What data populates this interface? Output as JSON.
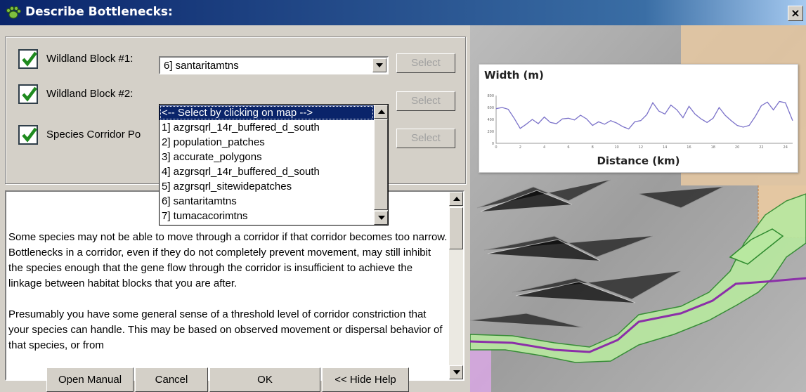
{
  "window": {
    "title": "Describe Bottlenecks:",
    "close_label": "×"
  },
  "inputs": {
    "rows": [
      {
        "checked": true,
        "label": "Wildland Block #1:",
        "select_label": "Select"
      },
      {
        "checked": true,
        "label": "Wildland Block #2:",
        "select_label": "Select"
      },
      {
        "checked": true,
        "label": "Species Corridor Po",
        "select_label": "Select"
      }
    ],
    "block1_value": "6] santaritamtns"
  },
  "dropdown": {
    "items": [
      {
        "label": "<-- Select by clicking on map -->",
        "selected": true
      },
      {
        "label": "1] azgrsqrl_14r_buffered_d_south",
        "selected": false
      },
      {
        "label": "2] population_patches",
        "selected": false
      },
      {
        "label": "3] accurate_polygons",
        "selected": false
      },
      {
        "label": "4] azgrsqrl_14r_buffered_d_south",
        "selected": false
      },
      {
        "label": "5] azgrsqrl_sitewidepatches",
        "selected": false
      },
      {
        "label": "6] santaritamtns",
        "selected": false
      },
      {
        "label": "7] tumacacorimtns",
        "selected": false
      }
    ]
  },
  "help": {
    "paragraphs": [
      "Some species may not be able to move through a corridor if that corridor becomes too narrow.  Bottlenecks in a corridor, even if they do not completely prevent movement, may still inhibit the species enough that the gene flow through the corridor is insufficient to achieve the linkage between habitat blocks that you are after.",
      "Presumably you have some general sense of a threshold level of corridor constriction that your species can handle. This may be based on observed movement or dispersal behavior of that species, or from"
    ]
  },
  "buttons": {
    "open_manual": "Open Manual",
    "cancel": "Cancel",
    "ok": "OK",
    "hide_help": "<< Hide Help"
  },
  "chart_data": {
    "type": "line",
    "ylabel": "Width (m)",
    "xlabel": "Distance (km)",
    "y_ticks": [
      "800",
      "600",
      "400",
      "200",
      "0"
    ],
    "x_ticks": [
      "0",
      "2",
      "4",
      "6",
      "8",
      "10",
      "12",
      "14",
      "16",
      "18",
      "20",
      "22",
      "24"
    ],
    "xlim": [
      0,
      24.6
    ],
    "ylim": [
      0,
      800
    ],
    "series_color": "#7b72c9",
    "x": [
      0,
      0.5,
      1.0,
      1.5,
      2.0,
      2.5,
      3.0,
      3.5,
      4.0,
      4.5,
      5.0,
      5.5,
      6.0,
      6.5,
      7.0,
      7.5,
      8.0,
      8.5,
      9.0,
      9.5,
      10.0,
      10.5,
      11.0,
      11.5,
      12.0,
      12.5,
      13.0,
      13.5,
      14.0,
      14.5,
      15.0,
      15.5,
      16.0,
      16.5,
      17.0,
      17.5,
      18.0,
      18.5,
      19.0,
      19.5,
      20.0,
      20.5,
      21.0,
      21.5,
      22.0,
      22.5,
      23.0,
      23.5,
      24.0,
      24.6
    ],
    "y": [
      580,
      600,
      570,
      420,
      250,
      320,
      400,
      330,
      440,
      350,
      330,
      410,
      420,
      390,
      470,
      410,
      300,
      360,
      320,
      380,
      340,
      280,
      240,
      360,
      380,
      480,
      680,
      540,
      490,
      640,
      560,
      430,
      620,
      490,
      410,
      350,
      420,
      600,
      470,
      380,
      300,
      270,
      300,
      450,
      630,
      690,
      560,
      700,
      680,
      380
    ]
  }
}
